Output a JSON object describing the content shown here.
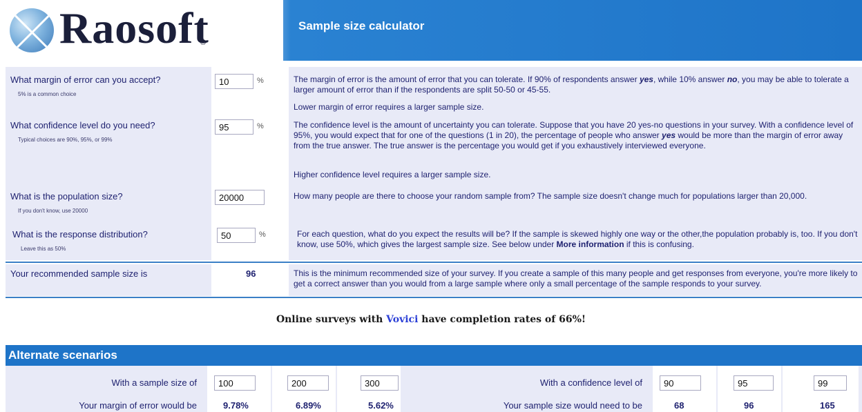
{
  "header": {
    "logo_text": "Raosoft",
    "logo_mark": "®",
    "title": "Sample size calculator"
  },
  "questions": [
    {
      "label": "What margin of error can you accept?",
      "hint": "5% is a common choice",
      "value": "10",
      "unit": "%",
      "desc": [
        "The margin of error is the amount of error that you can tolerate. If 90% of respondents answer ",
        "yes",
        ", while 10% answer ",
        "no",
        ", you may be able to tolerate a larger amount of error than if the respondents are split 50-50 or 45-55."
      ],
      "desc2": "Lower margin of error requires a larger sample size."
    },
    {
      "label": "What confidence level do you need?",
      "hint": "Typical choices are 90%, 95%, or 99%",
      "value": "95",
      "unit": "%",
      "desc": [
        "The confidence level is the amount of uncertainty you can tolerate. Suppose that you have 20 yes-no questions in your survey. With a confidence level of 95%, you would expect that for one of the questions (1 in 20), the percentage of people who answer ",
        "yes",
        " would be more than the margin of error away from the true answer. The true answer is the percentage you would get if you exhaustively interviewed everyone."
      ],
      "desc2": "Higher confidence level requires a larger sample size."
    },
    {
      "label": "What is the population size?",
      "hint": "If you don't know, use 20000",
      "value": "20000",
      "unit": "",
      "desc": [
        "How many people are there to choose your random sample from? The sample size doesn't change much for populations larger than 20,000."
      ]
    },
    {
      "label": "What is the response distribution?",
      "hint": "Leave this as 50%",
      "value": "50",
      "unit": "%",
      "desc": [
        "For each question, what do you expect the results will be? If the sample is skewed highly one way or the other,the population probably is, too. If you don't know, use 50%, which gives the largest sample size. See below under ",
        "More information",
        " if this is confusing."
      ]
    }
  ],
  "result": {
    "label": "Your recommended sample size is",
    "value": "96",
    "desc": "This is the minimum recommended size of your survey. If you create a sample of this many people and get responses from everyone, you're more likely to get a correct answer than you would from a large sample where only a small percentage of the sample responds to your survey."
  },
  "promo": {
    "before": "Online surveys with ",
    "link": "Vovici",
    "after": " have completion rates of 66%!"
  },
  "alternate": {
    "title": "Alternate scenarios",
    "sample_label": "With a sample size of",
    "sample_values": [
      "100",
      "200",
      "300"
    ],
    "margin_label": "Your margin of error would be",
    "margin_values": [
      "9.78%",
      "6.89%",
      "5.62%"
    ],
    "confidence_label": "With a confidence level of",
    "confidence_values": [
      "90",
      "95",
      "99"
    ],
    "size_label": "Your sample size would need to be",
    "size_values": [
      "68",
      "96",
      "165"
    ]
  }
}
